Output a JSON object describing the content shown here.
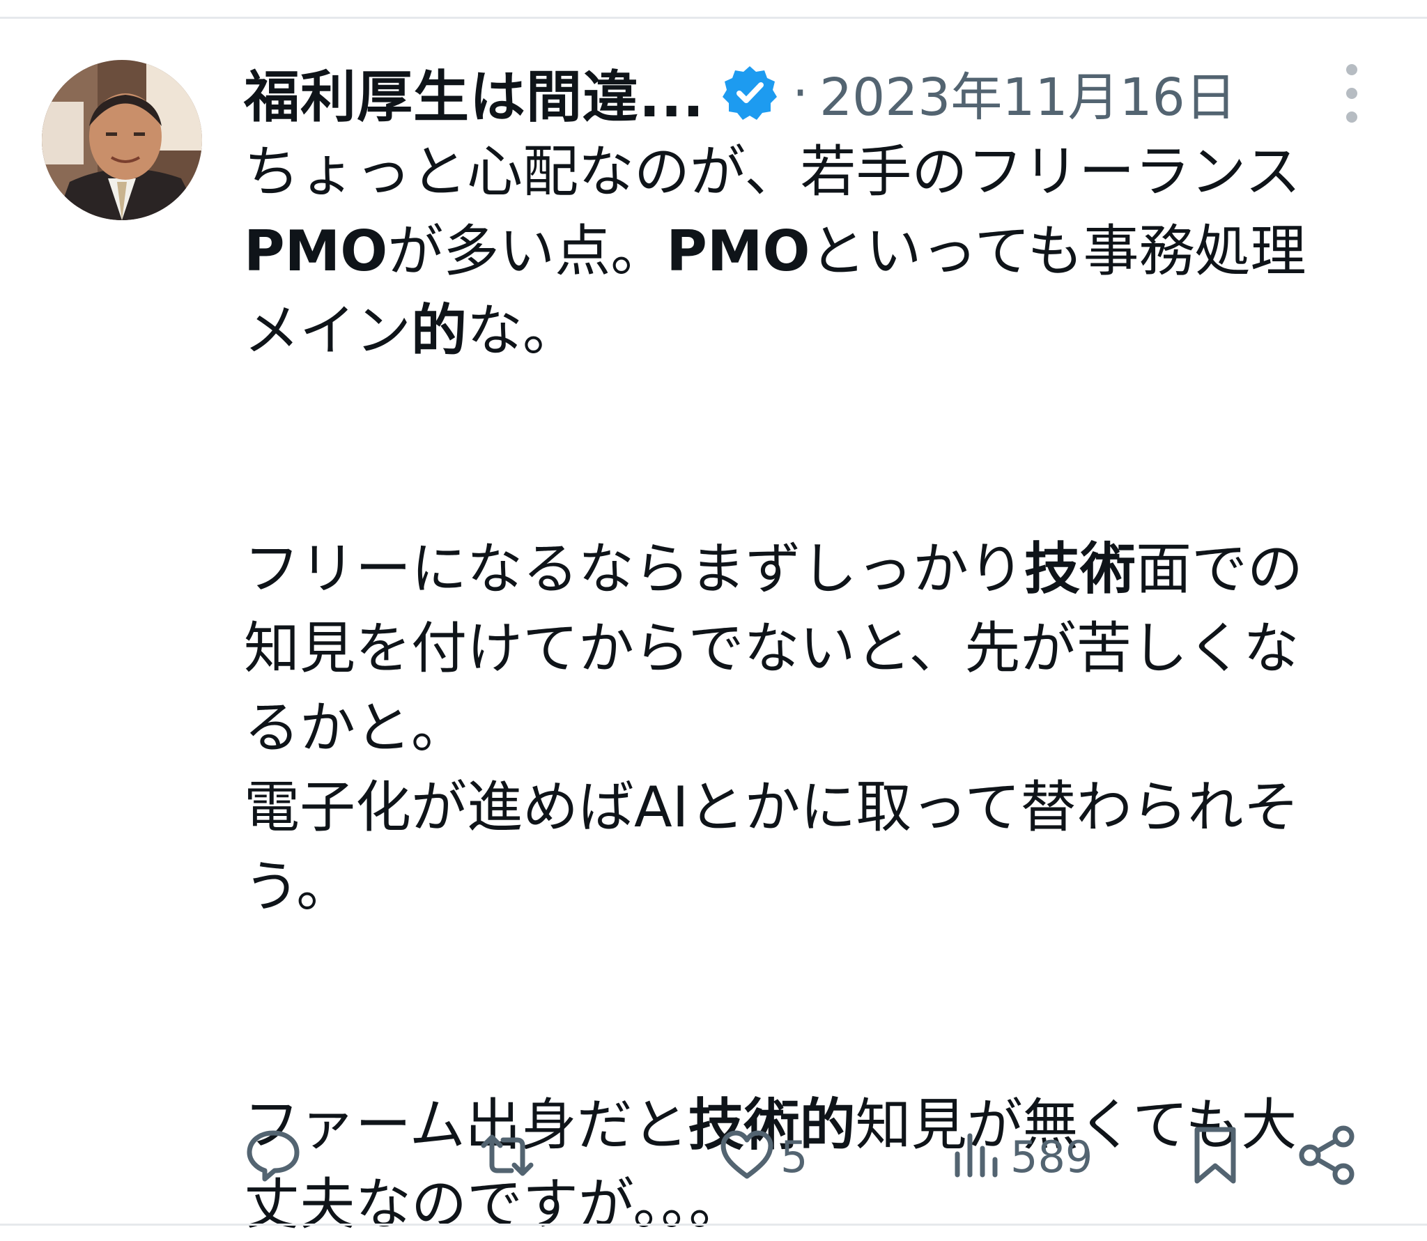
{
  "post": {
    "author": {
      "display_name": "福利厚生は間違...",
      "verified": true,
      "avatar": "avatar-photo"
    },
    "separator": "·",
    "timestamp": "2023年11月16日",
    "more_icon": "more-vertical-icon",
    "text_segments": {
      "l1": "ちょっと心配なのが、若手のフリーランス",
      "l2a": "PMO",
      "l2b": "が多い点。",
      "l2c": "PMO",
      "l2d": "といっても事務処理",
      "l3a": "メイン",
      "l3b": "的",
      "l3c": "な。",
      "l4a": "フリーになるならまずしっかり",
      "l4b": "技術",
      "l4c": "面での",
      "l5": "知見を付けてからでないと、先が苦しくな",
      "l6": "るかと。",
      "l7": "電子化が進めばAIとかに取って替わられそ",
      "l8": "う。",
      "l9a": "ファーム出身だと",
      "l9b": "技術的",
      "l9c": "知見が無くても大",
      "l10": "丈夫なのですが。。。"
    },
    "actions": {
      "reply": {
        "icon": "reply-icon",
        "count": ""
      },
      "repost": {
        "icon": "repost-icon",
        "count": ""
      },
      "like": {
        "icon": "heart-icon",
        "count": "5"
      },
      "views": {
        "icon": "views-icon",
        "count": "589"
      },
      "bookmark": {
        "icon": "bookmark-icon"
      },
      "share": {
        "icon": "share-icon"
      }
    }
  },
  "colors": {
    "text": "#0f1419",
    "secondary": "#536471",
    "verified": "#1d9bf0",
    "divider": "#e6e9ec"
  }
}
